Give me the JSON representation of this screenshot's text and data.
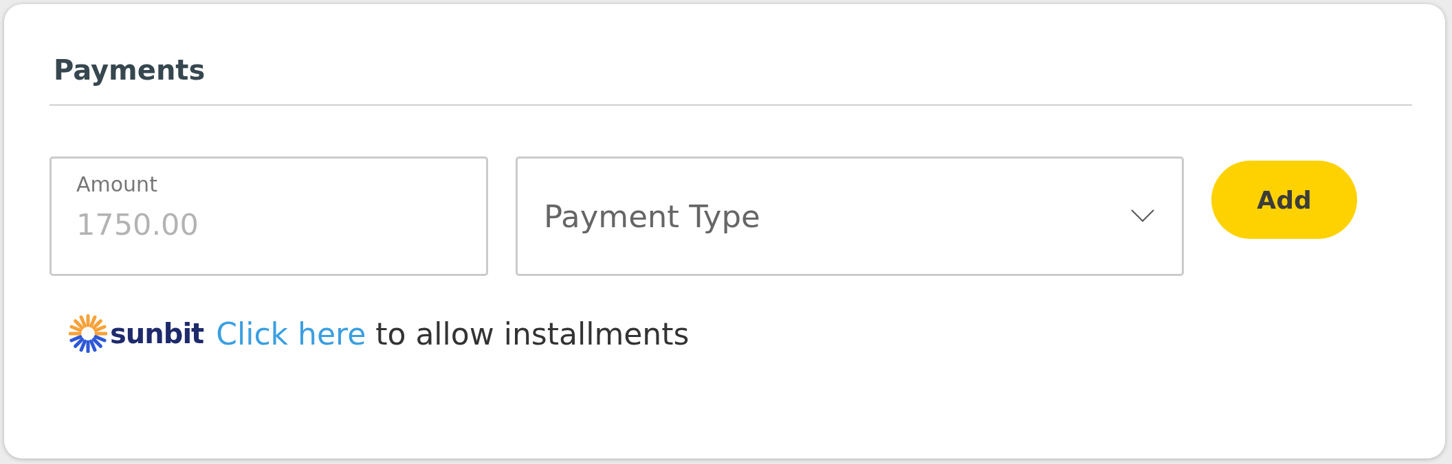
{
  "title": "Payments",
  "amount": {
    "label": "Amount",
    "placeholder": "1750.00"
  },
  "payment_type": {
    "placeholder": "Payment Type"
  },
  "add_button": "Add",
  "installments": {
    "brand": "sunbit",
    "link": "Click here",
    "text": "to allow installments"
  }
}
